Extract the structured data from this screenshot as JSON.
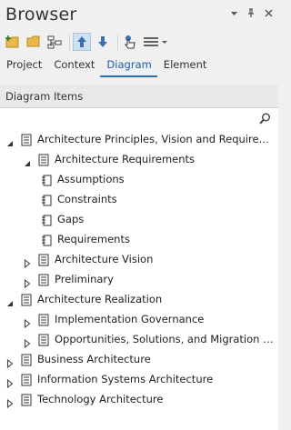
{
  "window": {
    "title": "Browser"
  },
  "tabs": [
    {
      "label": "Project"
    },
    {
      "label": "Context"
    },
    {
      "label": "Diagram"
    },
    {
      "label": "Element"
    }
  ],
  "active_tab": "Diagram",
  "section": {
    "title": "Diagram Items"
  },
  "tree": {
    "items": [
      {
        "label": "Architecture Principles, Vision and Requirements",
        "state": "expanded"
      },
      {
        "label": "Architecture Requirements",
        "state": "expanded"
      },
      {
        "label": "Assumptions"
      },
      {
        "label": "Constraints"
      },
      {
        "label": "Gaps"
      },
      {
        "label": "Requirements"
      },
      {
        "label": "Architecture Vision",
        "state": "collapsed"
      },
      {
        "label": "Preliminary",
        "state": "collapsed"
      },
      {
        "label": "Architecture Realization",
        "state": "expanded"
      },
      {
        "label": "Implementation Governance",
        "state": "collapsed"
      },
      {
        "label": "Opportunities, Solutions, and Migration Pla...",
        "state": "collapsed"
      },
      {
        "label": "Business Architecture",
        "state": "collapsed"
      },
      {
        "label": "Information Systems Architecture",
        "state": "collapsed"
      },
      {
        "label": "Technology Architecture",
        "state": "collapsed"
      }
    ]
  },
  "icons": {
    "toolbar": [
      "new-package-icon",
      "folder-icon",
      "hierarchy-icon",
      "move-up-icon",
      "move-down-icon",
      "pointer-hand-icon",
      "menu-icon"
    ],
    "tree_node": "diagram-icon",
    "tree_leaf": "element-icon"
  }
}
